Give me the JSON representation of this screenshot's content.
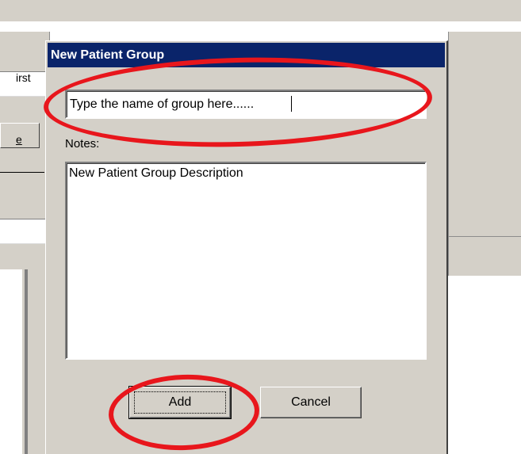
{
  "background": {
    "fragment_first": "irst",
    "fragment_e": "e"
  },
  "dialog": {
    "title": "New Patient Group",
    "name_field": {
      "value": "Type the name of group here......"
    },
    "notes_label": "Notes:",
    "notes_field": {
      "value": "New Patient Group Description"
    },
    "add_label": "Add",
    "cancel_label": "Cancel"
  },
  "annotations": {
    "color": "#e8161c",
    "highlighted": [
      "group-name-input",
      "add-button"
    ]
  },
  "colors": {
    "titlebar": "#0a246a",
    "face": "#d4d0c8"
  }
}
